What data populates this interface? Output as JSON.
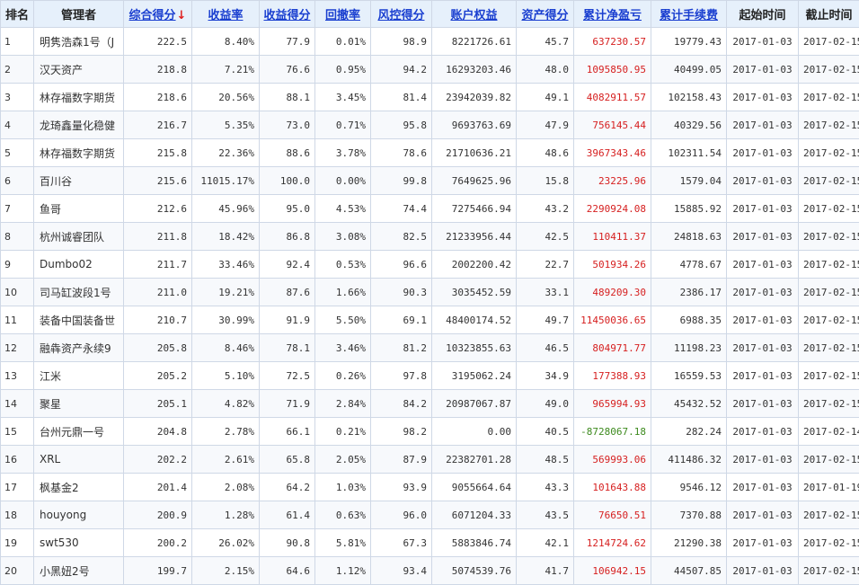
{
  "headers": {
    "rank": "排名",
    "manager": "管理者",
    "composite": "综合得分",
    "sort_arrow": "↓",
    "return_rate": "收益率",
    "return_score": "收益得分",
    "drawdown": "回撤率",
    "risk_score": "风控得分",
    "equity": "账户权益",
    "asset_score": "资产得分",
    "net_pnl": "累计净盈亏",
    "fees": "累计手续费",
    "start": "起始时间",
    "end": "截止时间"
  },
  "colors": {
    "positive": "#d62020",
    "negative": "#3d8a1e",
    "link": "#1a3fd0"
  },
  "rows": [
    {
      "rank": "1",
      "name": "明隽浩森1号（J",
      "composite": "222.5",
      "return_rate": "8.40%",
      "return_score": "77.9",
      "drawdown": "0.01%",
      "risk_score": "98.9",
      "equity": "8221726.61",
      "asset_score": "45.7",
      "net_pnl": "637230.57",
      "fees": "19779.43",
      "start": "2017-01-03",
      "end": "2017-02-15"
    },
    {
      "rank": "2",
      "name": "汉天资产",
      "composite": "218.8",
      "return_rate": "7.21%",
      "return_score": "76.6",
      "drawdown": "0.95%",
      "risk_score": "94.2",
      "equity": "16293203.46",
      "asset_score": "48.0",
      "net_pnl": "1095850.95",
      "fees": "40499.05",
      "start": "2017-01-03",
      "end": "2017-02-15"
    },
    {
      "rank": "3",
      "name": "林存福数字期货",
      "composite": "218.6",
      "return_rate": "20.56%",
      "return_score": "88.1",
      "drawdown": "3.45%",
      "risk_score": "81.4",
      "equity": "23942039.82",
      "asset_score": "49.1",
      "net_pnl": "4082911.57",
      "fees": "102158.43",
      "start": "2017-01-03",
      "end": "2017-02-15"
    },
    {
      "rank": "4",
      "name": "龙琦鑫量化稳健",
      "composite": "216.7",
      "return_rate": "5.35%",
      "return_score": "73.0",
      "drawdown": "0.71%",
      "risk_score": "95.8",
      "equity": "9693763.69",
      "asset_score": "47.9",
      "net_pnl": "756145.44",
      "fees": "40329.56",
      "start": "2017-01-03",
      "end": "2017-02-15"
    },
    {
      "rank": "5",
      "name": "林存福数字期货",
      "composite": "215.8",
      "return_rate": "22.36%",
      "return_score": "88.6",
      "drawdown": "3.78%",
      "risk_score": "78.6",
      "equity": "21710636.21",
      "asset_score": "48.6",
      "net_pnl": "3967343.46",
      "fees": "102311.54",
      "start": "2017-01-03",
      "end": "2017-02-15"
    },
    {
      "rank": "6",
      "name": "百川谷",
      "composite": "215.6",
      "return_rate": "11015.17%",
      "return_score": "100.0",
      "drawdown": "0.00%",
      "risk_score": "99.8",
      "equity": "7649625.96",
      "asset_score": "15.8",
      "net_pnl": "23225.96",
      "fees": "1579.04",
      "start": "2017-01-03",
      "end": "2017-02-15"
    },
    {
      "rank": "7",
      "name": "鱼哥",
      "composite": "212.6",
      "return_rate": "45.96%",
      "return_score": "95.0",
      "drawdown": "4.53%",
      "risk_score": "74.4",
      "equity": "7275466.94",
      "asset_score": "43.2",
      "net_pnl": "2290924.08",
      "fees": "15885.92",
      "start": "2017-01-03",
      "end": "2017-02-15"
    },
    {
      "rank": "8",
      "name": "杭州诚睿团队",
      "composite": "211.8",
      "return_rate": "18.42%",
      "return_score": "86.8",
      "drawdown": "3.08%",
      "risk_score": "82.5",
      "equity": "21233956.44",
      "asset_score": "42.5",
      "net_pnl": "110411.37",
      "fees": "24818.63",
      "start": "2017-01-03",
      "end": "2017-02-15"
    },
    {
      "rank": "9",
      "name": "Dumbo02",
      "composite": "211.7",
      "return_rate": "33.46%",
      "return_score": "92.4",
      "drawdown": "0.53%",
      "risk_score": "96.6",
      "equity": "2002200.42",
      "asset_score": "22.7",
      "net_pnl": "501934.26",
      "fees": "4778.67",
      "start": "2017-01-03",
      "end": "2017-02-15"
    },
    {
      "rank": "10",
      "name": "司马缸波段1号",
      "composite": "211.0",
      "return_rate": "19.21%",
      "return_score": "87.6",
      "drawdown": "1.66%",
      "risk_score": "90.3",
      "equity": "3035452.59",
      "asset_score": "33.1",
      "net_pnl": "489209.30",
      "fees": "2386.17",
      "start": "2017-01-03",
      "end": "2017-02-15"
    },
    {
      "rank": "11",
      "name": "装备中国装备世",
      "composite": "210.7",
      "return_rate": "30.99%",
      "return_score": "91.9",
      "drawdown": "5.50%",
      "risk_score": "69.1",
      "equity": "48400174.52",
      "asset_score": "49.7",
      "net_pnl": "11450036.65",
      "fees": "6988.35",
      "start": "2017-01-03",
      "end": "2017-02-15"
    },
    {
      "rank": "12",
      "name": "融犇资产永续9",
      "composite": "205.8",
      "return_rate": "8.46%",
      "return_score": "78.1",
      "drawdown": "3.46%",
      "risk_score": "81.2",
      "equity": "10323855.63",
      "asset_score": "46.5",
      "net_pnl": "804971.77",
      "fees": "11198.23",
      "start": "2017-01-03",
      "end": "2017-02-15"
    },
    {
      "rank": "13",
      "name": "江米",
      "composite": "205.2",
      "return_rate": "5.10%",
      "return_score": "72.5",
      "drawdown": "0.26%",
      "risk_score": "97.8",
      "equity": "3195062.24",
      "asset_score": "34.9",
      "net_pnl": "177388.93",
      "fees": "16559.53",
      "start": "2017-01-03",
      "end": "2017-02-15"
    },
    {
      "rank": "14",
      "name": "聚星",
      "composite": "205.1",
      "return_rate": "4.82%",
      "return_score": "71.9",
      "drawdown": "2.84%",
      "risk_score": "84.2",
      "equity": "20987067.87",
      "asset_score": "49.0",
      "net_pnl": "965994.93",
      "fees": "45432.52",
      "start": "2017-01-03",
      "end": "2017-02-15"
    },
    {
      "rank": "15",
      "name": "台州元鼎一号",
      "composite": "204.8",
      "return_rate": "2.78%",
      "return_score": "66.1",
      "drawdown": "0.21%",
      "risk_score": "98.2",
      "equity": "0.00",
      "asset_score": "40.5",
      "net_pnl": "-8728067.18",
      "fees": "282.24",
      "start": "2017-01-03",
      "end": "2017-02-14"
    },
    {
      "rank": "16",
      "name": "XRL",
      "composite": "202.2",
      "return_rate": "2.61%",
      "return_score": "65.8",
      "drawdown": "2.05%",
      "risk_score": "87.9",
      "equity": "22382701.28",
      "asset_score": "48.5",
      "net_pnl": "569993.06",
      "fees": "411486.32",
      "start": "2017-01-03",
      "end": "2017-02-15"
    },
    {
      "rank": "17",
      "name": "枫基金2",
      "composite": "201.4",
      "return_rate": "2.08%",
      "return_score": "64.2",
      "drawdown": "1.03%",
      "risk_score": "93.9",
      "equity": "9055664.64",
      "asset_score": "43.3",
      "net_pnl": "101643.88",
      "fees": "9546.12",
      "start": "2017-01-03",
      "end": "2017-01-19"
    },
    {
      "rank": "18",
      "name": "houyong",
      "composite": "200.9",
      "return_rate": "1.28%",
      "return_score": "61.4",
      "drawdown": "0.63%",
      "risk_score": "96.0",
      "equity": "6071204.33",
      "asset_score": "43.5",
      "net_pnl": "76650.51",
      "fees": "7370.88",
      "start": "2017-01-03",
      "end": "2017-02-15"
    },
    {
      "rank": "19",
      "name": "swt530",
      "composite": "200.2",
      "return_rate": "26.02%",
      "return_score": "90.8",
      "drawdown": "5.81%",
      "risk_score": "67.3",
      "equity": "5883846.74",
      "asset_score": "42.1",
      "net_pnl": "1214724.62",
      "fees": "21290.38",
      "start": "2017-01-03",
      "end": "2017-02-15"
    },
    {
      "rank": "20",
      "name": "小黑妞2号",
      "composite": "199.7",
      "return_rate": "2.15%",
      "return_score": "64.6",
      "drawdown": "1.12%",
      "risk_score": "93.4",
      "equity": "5074539.76",
      "asset_score": "41.7",
      "net_pnl": "106942.15",
      "fees": "44507.85",
      "start": "2017-01-03",
      "end": "2017-02-15"
    }
  ]
}
